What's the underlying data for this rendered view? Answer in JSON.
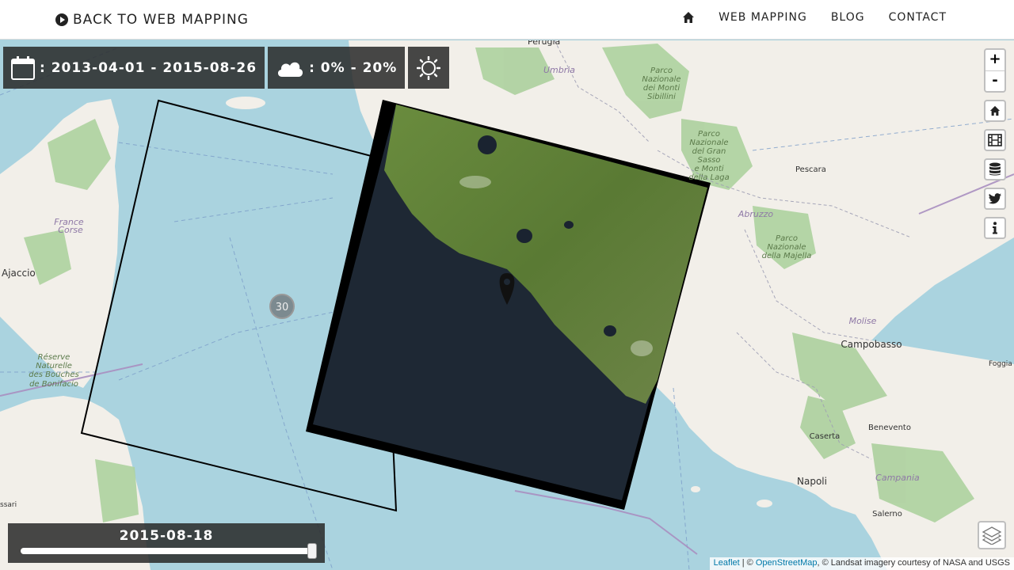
{
  "header": {
    "back_label": "BACK TO WEB MAPPING",
    "nav_items": [
      "WEB MAPPING",
      "BLOG",
      "CONTACT"
    ]
  },
  "filters": {
    "date_range": ": 2013-04-01 - 2015-08-26",
    "cloud_range": ": 0% - 20%"
  },
  "controls": {
    "zoom_in": "+",
    "zoom_out": "-"
  },
  "map": {
    "cluster_count": "30",
    "labels": {
      "perugia": "Perugia",
      "umbria": "Umbria",
      "sibillini": [
        "Parco",
        "Nazionale",
        "dei Monti",
        "Sibillini"
      ],
      "gran_sasso": [
        "Parco",
        "Nazionale",
        "del Gran",
        "Sasso",
        "e Monti",
        "della Laga"
      ],
      "pescara": "Pescara",
      "abruzzo": "Abruzzo",
      "majella": [
        "Parco",
        "Nazionale",
        "della Majella"
      ],
      "molise": "Molise",
      "campobasso": "Campobasso",
      "foggia": "Foggia",
      "benevento": "Benevento",
      "caserta": "Caserta",
      "napoli": "Napoli",
      "campania": "Campania",
      "salerno": "Salerno",
      "france": "France",
      "corse": "Corse",
      "ajaccio": "Ajaccio",
      "bonifacio": [
        "Réserve",
        "Naturelle",
        "des Bouches",
        "de Bonifacio"
      ],
      "sassari": "ssari"
    },
    "colors": {
      "sea": "#aad3df",
      "land": "#f2efe9",
      "forest": "#add19e",
      "imagery_sea": "#1e2834",
      "imagery_land": "#5c7a3c"
    }
  },
  "slider": {
    "date": "2015-08-18",
    "position_fraction": 0.99
  },
  "attribution": {
    "leaflet": "Leaflet",
    "separator": " | © ",
    "osm": "OpenStreetMap",
    "landsat": ", © Landsat imagery courtesy of NASA and USGS"
  }
}
